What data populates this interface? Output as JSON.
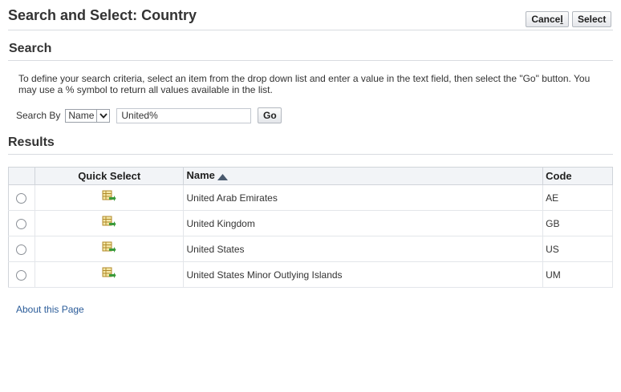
{
  "header": {
    "title": "Search and Select: Country",
    "cancel_label_pre": "Cance",
    "cancel_label_accel": "l",
    "select_label": "Select"
  },
  "search": {
    "heading": "Search",
    "instructions": "To define your search criteria, select an item from the drop down list and enter a value in the text field, then select the \"Go\" button. You may use a % symbol to return all values available in the list.",
    "search_by_label": "Search By",
    "search_by_selected": "Name",
    "search_value": "United%",
    "go_label": "Go"
  },
  "results": {
    "heading": "Results",
    "columns": {
      "quick_select": "Quick Select",
      "name": "Name",
      "code": "Code"
    },
    "sort": {
      "column": "name",
      "direction": "ascending"
    },
    "rows": [
      {
        "name": "United Arab Emirates",
        "code": "AE"
      },
      {
        "name": "United Kingdom",
        "code": "GB"
      },
      {
        "name": "United States",
        "code": "US"
      },
      {
        "name": "United States Minor Outlying Islands",
        "code": "UM"
      }
    ]
  },
  "footer": {
    "about_link": "About this Page"
  },
  "icons": {
    "quick_select": "quick-select-icon",
    "sort": "sort-ascending-icon",
    "dropdown": "chevron-down-icon"
  },
  "colors": {
    "link": "#2b5c99",
    "table_header_bg": "#f2f4f7",
    "divider": "#d8dbe0"
  }
}
